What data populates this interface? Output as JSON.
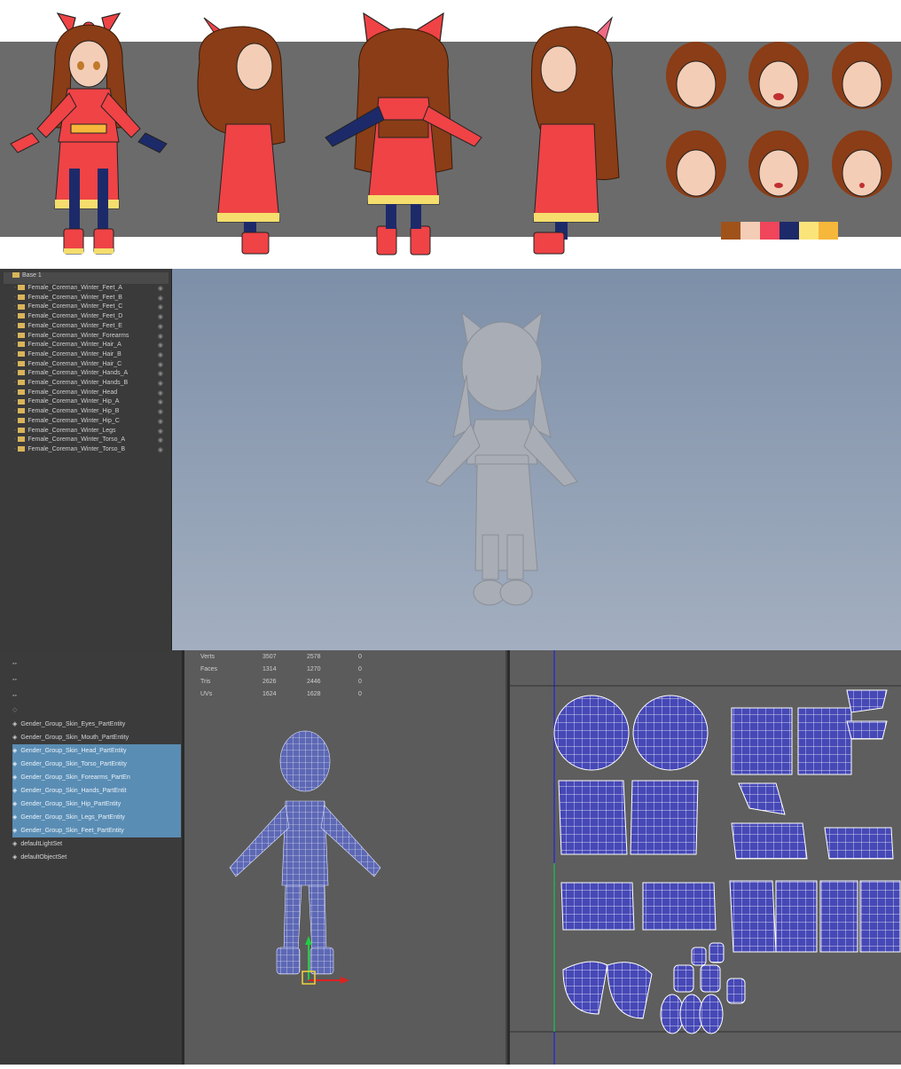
{
  "colors": {
    "palette": [
      "#a0521b",
      "#f4cdb6",
      "#f0455a",
      "#1d2a6a",
      "#fae47a",
      "#f6b73a"
    ],
    "dress_red": "#ef4346",
    "hair_brown": "#8a3d16",
    "trim_yellow": "#f5de6d",
    "navy": "#1d2a6a",
    "viewport_blue": "#8c9cb2",
    "uv_blue": "#4648b6",
    "selection_blue": "#5a8db4"
  },
  "outliner_top": {
    "root": "Base 1",
    "items": [
      "Female_Coreman_Winter_Feet_A",
      "Female_Coreman_Winter_Feet_B",
      "Female_Coreman_Winter_Feet_C",
      "Female_Coreman_Winter_Feet_D",
      "Female_Coreman_Winter_Feet_E",
      "Female_Coreman_Winter_Forearms",
      "Female_Coreman_Winter_Hair_A",
      "Female_Coreman_Winter_Hair_B",
      "Female_Coreman_Winter_Hair_C",
      "Female_Coreman_Winter_Hands_A",
      "Female_Coreman_Winter_Hands_B",
      "Female_Coreman_Winter_Head",
      "Female_Coreman_Winter_Hip_A",
      "Female_Coreman_Winter_Hip_B",
      "Female_Coreman_Winter_Hip_C",
      "Female_Coreman_Winter_Legs",
      "Female_Coreman_Winter_Torso_A",
      "Female_Coreman_Winter_Torso_B"
    ]
  },
  "outliner_bottom": {
    "items": [
      {
        "label": "Gender_Group_Skin_Eyes_PartEntity",
        "selected": false
      },
      {
        "label": "Gender_Group_Skin_Mouth_PartEntity",
        "selected": false
      },
      {
        "label": "Gender_Group_Skin_Head_PartEntity",
        "selected": true
      },
      {
        "label": "Gender_Group_Skin_Torso_PartEntity",
        "selected": true
      },
      {
        "label": "Gender_Group_Skin_Forearms_PartEn",
        "selected": true
      },
      {
        "label": "Gender_Group_Skin_Hands_PartEntit",
        "selected": true
      },
      {
        "label": "Gender_Group_Skin_Hip_PartEntity",
        "selected": true
      },
      {
        "label": "Gender_Group_Skin_Legs_PartEntity",
        "selected": true
      },
      {
        "label": "Gender_Group_Skin_Feet_PartEntity",
        "selected": true
      },
      {
        "label": "defaultLightSet",
        "selected": false
      },
      {
        "label": "defaultObjectSet",
        "selected": false
      }
    ]
  },
  "stats": {
    "rows": [
      {
        "label": "Verts",
        "a": "3507",
        "b": "2578",
        "c": "0"
      },
      {
        "label": "Faces",
        "a": "1314",
        "b": "1270",
        "c": "0"
      },
      {
        "label": "Tris",
        "a": "2626",
        "b": "2446",
        "c": "0"
      },
      {
        "label": "UVs",
        "a": "1624",
        "b": "1628",
        "c": "0"
      }
    ]
  },
  "icons": [
    "folder-icon",
    "eye-icon",
    "mesh-icon",
    "set-icon",
    "move-manipulator-icon"
  ]
}
